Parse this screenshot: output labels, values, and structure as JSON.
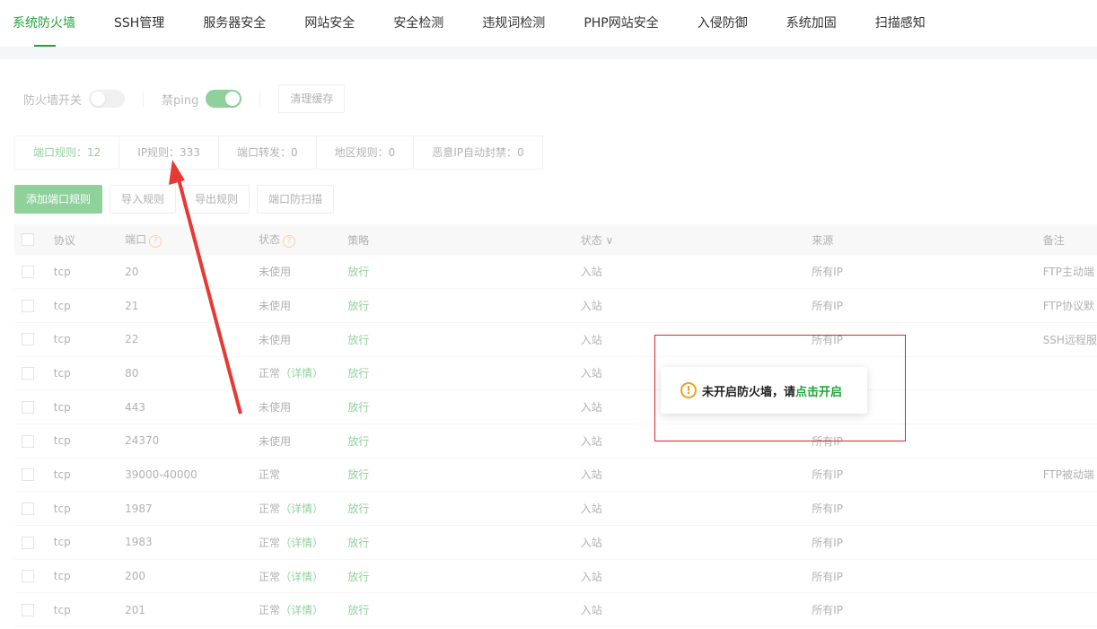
{
  "nav": {
    "tabs": [
      "系统防火墙",
      "SSH管理",
      "服务器安全",
      "网站安全",
      "安全检测",
      "违规词检测",
      "PHP网站安全",
      "入侵防御",
      "系统加固",
      "扫描感知"
    ],
    "active": 0
  },
  "controls": {
    "firewall_label": "防火墙开关",
    "ping_label": "禁ping",
    "clear_cache": "清理缓存"
  },
  "subtabs": [
    "端口规则：12",
    "IP规则：333",
    "端口转发：0",
    "地区规则：0",
    "恶意IP自动封禁：0"
  ],
  "actions": {
    "add": "添加端口规则",
    "import": "导入规则",
    "export": "导出规则",
    "scan": "端口防扫描"
  },
  "table": {
    "headers": [
      "协议",
      "端口",
      "状态",
      "策略",
      "状态",
      "来源",
      "备注"
    ],
    "rows": [
      {
        "proto": "tcp",
        "port": "20",
        "status": "未使用",
        "detail": "",
        "policy": "放行",
        "dir": "入站",
        "src": "所有IP",
        "note": "FTP主动端"
      },
      {
        "proto": "tcp",
        "port": "21",
        "status": "未使用",
        "detail": "",
        "policy": "放行",
        "dir": "入站",
        "src": "所有IP",
        "note": "FTP协议默"
      },
      {
        "proto": "tcp",
        "port": "22",
        "status": "未使用",
        "detail": "",
        "policy": "放行",
        "dir": "入站",
        "src": "所有IP",
        "note": "SSH远程服"
      },
      {
        "proto": "tcp",
        "port": "80",
        "status": "正常",
        "detail": "（详情）",
        "policy": "放行",
        "dir": "入站",
        "src": "",
        "note": ""
      },
      {
        "proto": "tcp",
        "port": "443",
        "status": "未使用",
        "detail": "",
        "policy": "放行",
        "dir": "入站",
        "src": "",
        "note": ""
      },
      {
        "proto": "tcp",
        "port": "24370",
        "status": "未使用",
        "detail": "",
        "policy": "放行",
        "dir": "入站",
        "src": "所有IP",
        "note": ""
      },
      {
        "proto": "tcp",
        "port": "39000-40000",
        "status": "正常",
        "detail": "",
        "policy": "放行",
        "dir": "入站",
        "src": "所有IP",
        "note": "FTP被动端"
      },
      {
        "proto": "tcp",
        "port": "1987",
        "status": "正常",
        "detail": "（详情）",
        "policy": "放行",
        "dir": "入站",
        "src": "所有IP",
        "note": ""
      },
      {
        "proto": "tcp",
        "port": "1983",
        "status": "正常",
        "detail": "（详情）",
        "policy": "放行",
        "dir": "入站",
        "src": "所有IP",
        "note": ""
      },
      {
        "proto": "tcp",
        "port": "200",
        "status": "正常",
        "detail": "（详情）",
        "policy": "放行",
        "dir": "入站",
        "src": "所有IP",
        "note": ""
      },
      {
        "proto": "tcp",
        "port": "201",
        "status": "正常",
        "detail": "（详情）",
        "policy": "放行",
        "dir": "入站",
        "src": "所有IP",
        "note": ""
      }
    ]
  },
  "toast": {
    "message": "未开启防火墙，请",
    "link": "点击开启"
  }
}
